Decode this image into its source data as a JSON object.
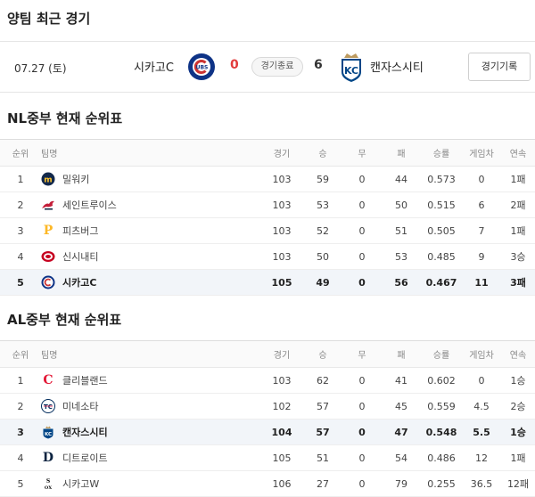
{
  "recent": {
    "title": "양팀 최근 경기",
    "date": "07.27 (토)",
    "away_team": "시카고C",
    "away_score": "0",
    "status": "경기종료",
    "home_score": "6",
    "home_team": "캔자스시티",
    "record_button": "경기기록",
    "colors": {
      "lose": "#e23b3b",
      "cubs": "#0e3386",
      "royals": "#004687"
    }
  },
  "columns": [
    "순위",
    "팀명",
    "경기",
    "승",
    "무",
    "패",
    "승률",
    "게임차",
    "연속"
  ],
  "nl": {
    "title": "NL중부 현재 순위표",
    "rows": [
      {
        "rank": "1",
        "team": "밀워키",
        "logo": "brewers-logo",
        "g": "103",
        "w": "59",
        "d": "0",
        "l": "44",
        "pct": "0.573",
        "gb": "0",
        "streak": "1패",
        "highlight": false
      },
      {
        "rank": "2",
        "team": "세인트루이스",
        "logo": "cardinals-logo",
        "g": "103",
        "w": "53",
        "d": "0",
        "l": "50",
        "pct": "0.515",
        "gb": "6",
        "streak": "2패",
        "highlight": false
      },
      {
        "rank": "3",
        "team": "피츠버그",
        "logo": "pirates-logo",
        "g": "103",
        "w": "52",
        "d": "0",
        "l": "51",
        "pct": "0.505",
        "gb": "7",
        "streak": "1패",
        "highlight": false
      },
      {
        "rank": "4",
        "team": "신시내티",
        "logo": "reds-logo",
        "g": "103",
        "w": "50",
        "d": "0",
        "l": "53",
        "pct": "0.485",
        "gb": "9",
        "streak": "3승",
        "highlight": false
      },
      {
        "rank": "5",
        "team": "시카고C",
        "logo": "cubs-logo",
        "g": "105",
        "w": "49",
        "d": "0",
        "l": "56",
        "pct": "0.467",
        "gb": "11",
        "streak": "3패",
        "highlight": true
      }
    ]
  },
  "al": {
    "title": "AL중부 현재 순위표",
    "rows": [
      {
        "rank": "1",
        "team": "클리블랜드",
        "logo": "guardians-logo",
        "g": "103",
        "w": "62",
        "d": "0",
        "l": "41",
        "pct": "0.602",
        "gb": "0",
        "streak": "1승",
        "highlight": false
      },
      {
        "rank": "2",
        "team": "미네소타",
        "logo": "twins-logo",
        "g": "102",
        "w": "57",
        "d": "0",
        "l": "45",
        "pct": "0.559",
        "gb": "4.5",
        "streak": "2승",
        "highlight": false
      },
      {
        "rank": "3",
        "team": "캔자스시티",
        "logo": "royals-logo",
        "g": "104",
        "w": "57",
        "d": "0",
        "l": "47",
        "pct": "0.548",
        "gb": "5.5",
        "streak": "1승",
        "highlight": true
      },
      {
        "rank": "4",
        "team": "디트로이트",
        "logo": "tigers-logo",
        "g": "105",
        "w": "51",
        "d": "0",
        "l": "54",
        "pct": "0.486",
        "gb": "12",
        "streak": "1패",
        "highlight": false
      },
      {
        "rank": "5",
        "team": "시카고W",
        "logo": "whitesox-logo",
        "g": "106",
        "w": "27",
        "d": "0",
        "l": "79",
        "pct": "0.255",
        "gb": "36.5",
        "streak": "12패",
        "highlight": false
      }
    ]
  }
}
